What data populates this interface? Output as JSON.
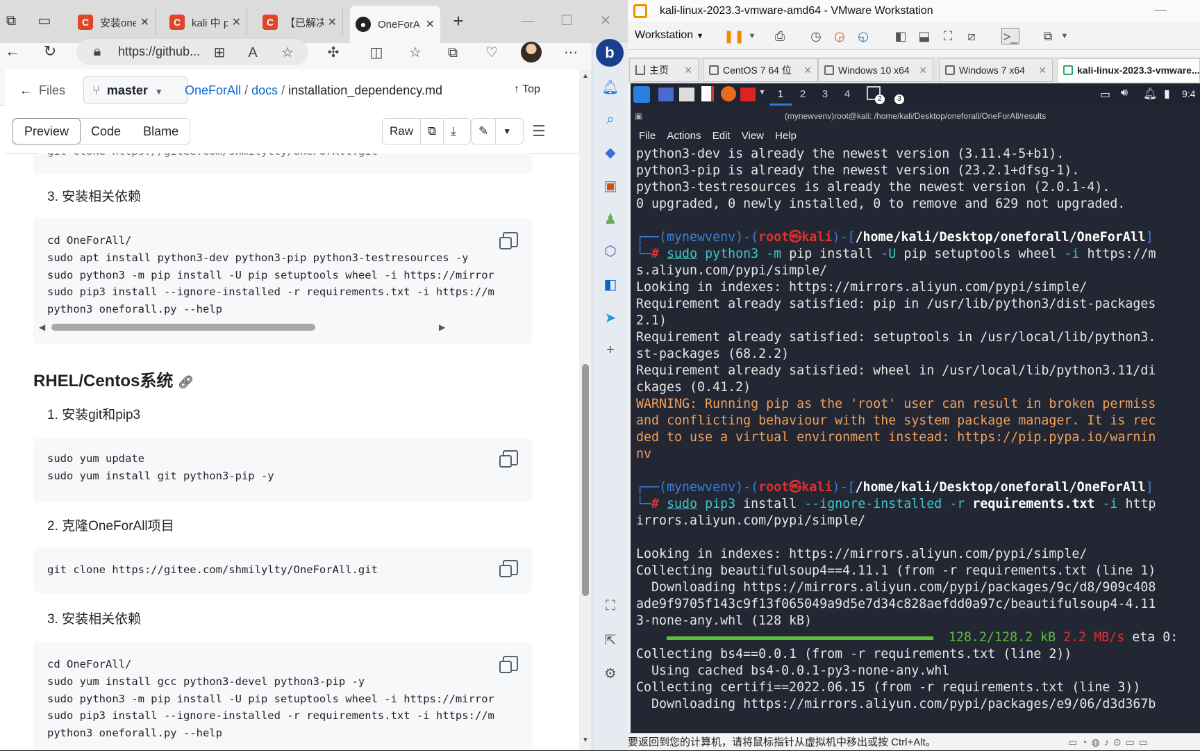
{
  "browser": {
    "tabs": [
      {
        "title": "安装one",
        "icon": "C",
        "close": "✕"
      },
      {
        "title": "kali 中 p",
        "icon": "C",
        "close": "✕"
      },
      {
        "title": "【已解决",
        "icon": "C",
        "close": "✕"
      },
      {
        "title": "OneForAll",
        "icon": "github-icon",
        "close": "✕"
      }
    ],
    "new_tab": "+",
    "window_controls": {
      "minimize": "—",
      "maximize": "☐",
      "close": "✕"
    },
    "address": "https://github...",
    "icons": [
      "back-icon",
      "refresh-icon",
      "lock-icon",
      "app-icon",
      "read-aloud-icon",
      "favorite-icon",
      "extensions-icon",
      "split-icon",
      "favorites-icon",
      "collections-icon",
      "health-icon",
      "profile-avatar",
      "more-icon"
    ]
  },
  "github": {
    "files_label": "Files",
    "branch": "master",
    "breadcrumb": {
      "repo": "OneForAll",
      "sep": "/",
      "folder": "docs",
      "file": "installation_dependency.md"
    },
    "top_label": "Top",
    "view_tabs": [
      "Preview",
      "Code",
      "Blame"
    ],
    "raw_label": "Raw",
    "top_code_fragment": "git clone https://gitee.com/shmilylty/OneForAll.git",
    "section1_step3": "3. 安装相关依赖",
    "code1": [
      "cd OneForAll/",
      "sudo apt install python3-dev python3-pip python3-testresources -y",
      "sudo python3 -m pip install -U pip setuptools wheel -i https://mirror",
      "sudo pip3 install --ignore-installed -r requirements.txt -i https://m",
      "python3 oneforall.py --help"
    ],
    "heading_rhel": "RHEL/Centos系统",
    "step1": "1. 安装git和pip3",
    "code2": [
      "sudo yum update",
      "sudo yum install git python3-pip -y"
    ],
    "step2": "2. 克隆OneForAll项目",
    "code3": [
      "git clone https://gitee.com/shmilylty/OneForAll.git"
    ],
    "step3": "3. 安装相关依赖",
    "code4": [
      "cd OneForAll/",
      "sudo yum install gcc python3-devel python3-pip -y",
      "sudo python3 -m pip install -U pip setuptools wheel -i https://mirror",
      "sudo pip3 install --ignore-installed -r requirements.txt -i https://m",
      "python3 oneforall.py --help"
    ]
  },
  "vmware": {
    "title": "kali-linux-2023.3-vmware-amd64 - VMware Workstation",
    "workstation_label": "Workstation",
    "window_controls": {
      "minimize": "—",
      "maximize": "☐",
      "close": "✕"
    },
    "tabs": [
      "主页",
      "CentOS 7 64 位",
      "Windows 10 x64",
      "Windows 7 x64",
      "kali-linux-2023.3-vmware..."
    ],
    "tab_close": "✕",
    "status": "要返回到您的计算机，请将鼠标指针从虚拟机中移出或按 Ctrl+Alt。"
  },
  "kali": {
    "workspaces": [
      "1",
      "2",
      "3",
      "4"
    ],
    "badge_a": "2",
    "badge_b": "3",
    "clock": "9:4",
    "terminal_title": "(mynewvenv)root@kali: /home/kali/Desktop/oneforall/OneForAll/results",
    "menu": [
      "File",
      "Actions",
      "Edit",
      "View",
      "Help"
    ],
    "lines": {
      "l1": "python3-dev is already the newest version (3.11.4-5+b1).",
      "l2": "python3-pip is already the newest version (23.2.1+dfsg-1).",
      "l3": "python3-testresources is already the newest version (2.0.1-4).",
      "l4": "0 upgraded, 0 newly installed, 0 to remove and 629 not upgraded.",
      "p1_venv": "mynewvenv",
      "p1_user": "root㉿kali",
      "p1_path": "/home/kali/Desktop/oneforall/OneForAll",
      "p1_sudo": "sudo",
      "p1_cmd_a": "python3",
      "p1_cmd_b": "-m",
      "p1_cmd_c": "pip install",
      "p1_cmd_d": "-U",
      "p1_cmd_e": "pip setuptools wheel",
      "p1_cmd_f": "-i",
      "p1_cmd_g": "https://m",
      "l5": "s.aliyun.com/pypi/simple/",
      "l6": "Looking in indexes: https://mirrors.aliyun.com/pypi/simple/",
      "l7": "Requirement already satisfied: pip in /usr/lib/python3/dist-packages",
      "l8": "2.1)",
      "l9": "Requirement already satisfied: setuptools in /usr/local/lib/python3.",
      "l10": "st-packages (68.2.2)",
      "l11": "Requirement already satisfied: wheel in /usr/local/lib/python3.11/di",
      "l12": "ckages (0.41.2)",
      "w1": "WARNING: Running pip as the 'root' user can result in broken permiss",
      "w2": "and conflicting behaviour with the system package manager. It is rec",
      "w3": "ded to use a virtual environment instead: https://pip.pypa.io/warnin",
      "w4": "nv",
      "p2_sudo": "sudo",
      "p2_cmd_a": "pip3",
      "p2_cmd_b": "install",
      "p2_cmd_c": "--ignore-installed",
      "p2_cmd_d": "-r",
      "p2_cmd_e": "requirements.txt",
      "p2_cmd_f": "-i",
      "p2_cmd_g": "http",
      "l13": "irrors.aliyun.com/pypi/simple/",
      "l14": "Looking in indexes: https://mirrors.aliyun.com/pypi/simple/",
      "l15": "Collecting beautifulsoup4==4.11.1 (from -r requirements.txt (line 1)",
      "l16": "  Downloading https://mirrors.aliyun.com/pypi/packages/9c/d8/909c408",
      "l17": "ade9f9705f143c9f13f065049a9d5e7d34c828aefdd0a97c/beautifulsoup4-4.11",
      "l18": "3-none-any.whl (128 kB)",
      "prog_size": "128.2/128.2 kB",
      "prog_speed": "2.2 MB/s",
      "prog_eta": "eta 0:",
      "l19": "Collecting bs4==0.0.1 (from -r requirements.txt (line 2))",
      "l20": "  Using cached bs4-0.0.1-py3-none-any.whl",
      "l21": "Collecting certifi==2022.06.15 (from -r requirements.txt (line 3))",
      "l22": "  Downloading https://mirrors.aliyun.com/pypi/packages/e9/06/d3d367b"
    }
  }
}
